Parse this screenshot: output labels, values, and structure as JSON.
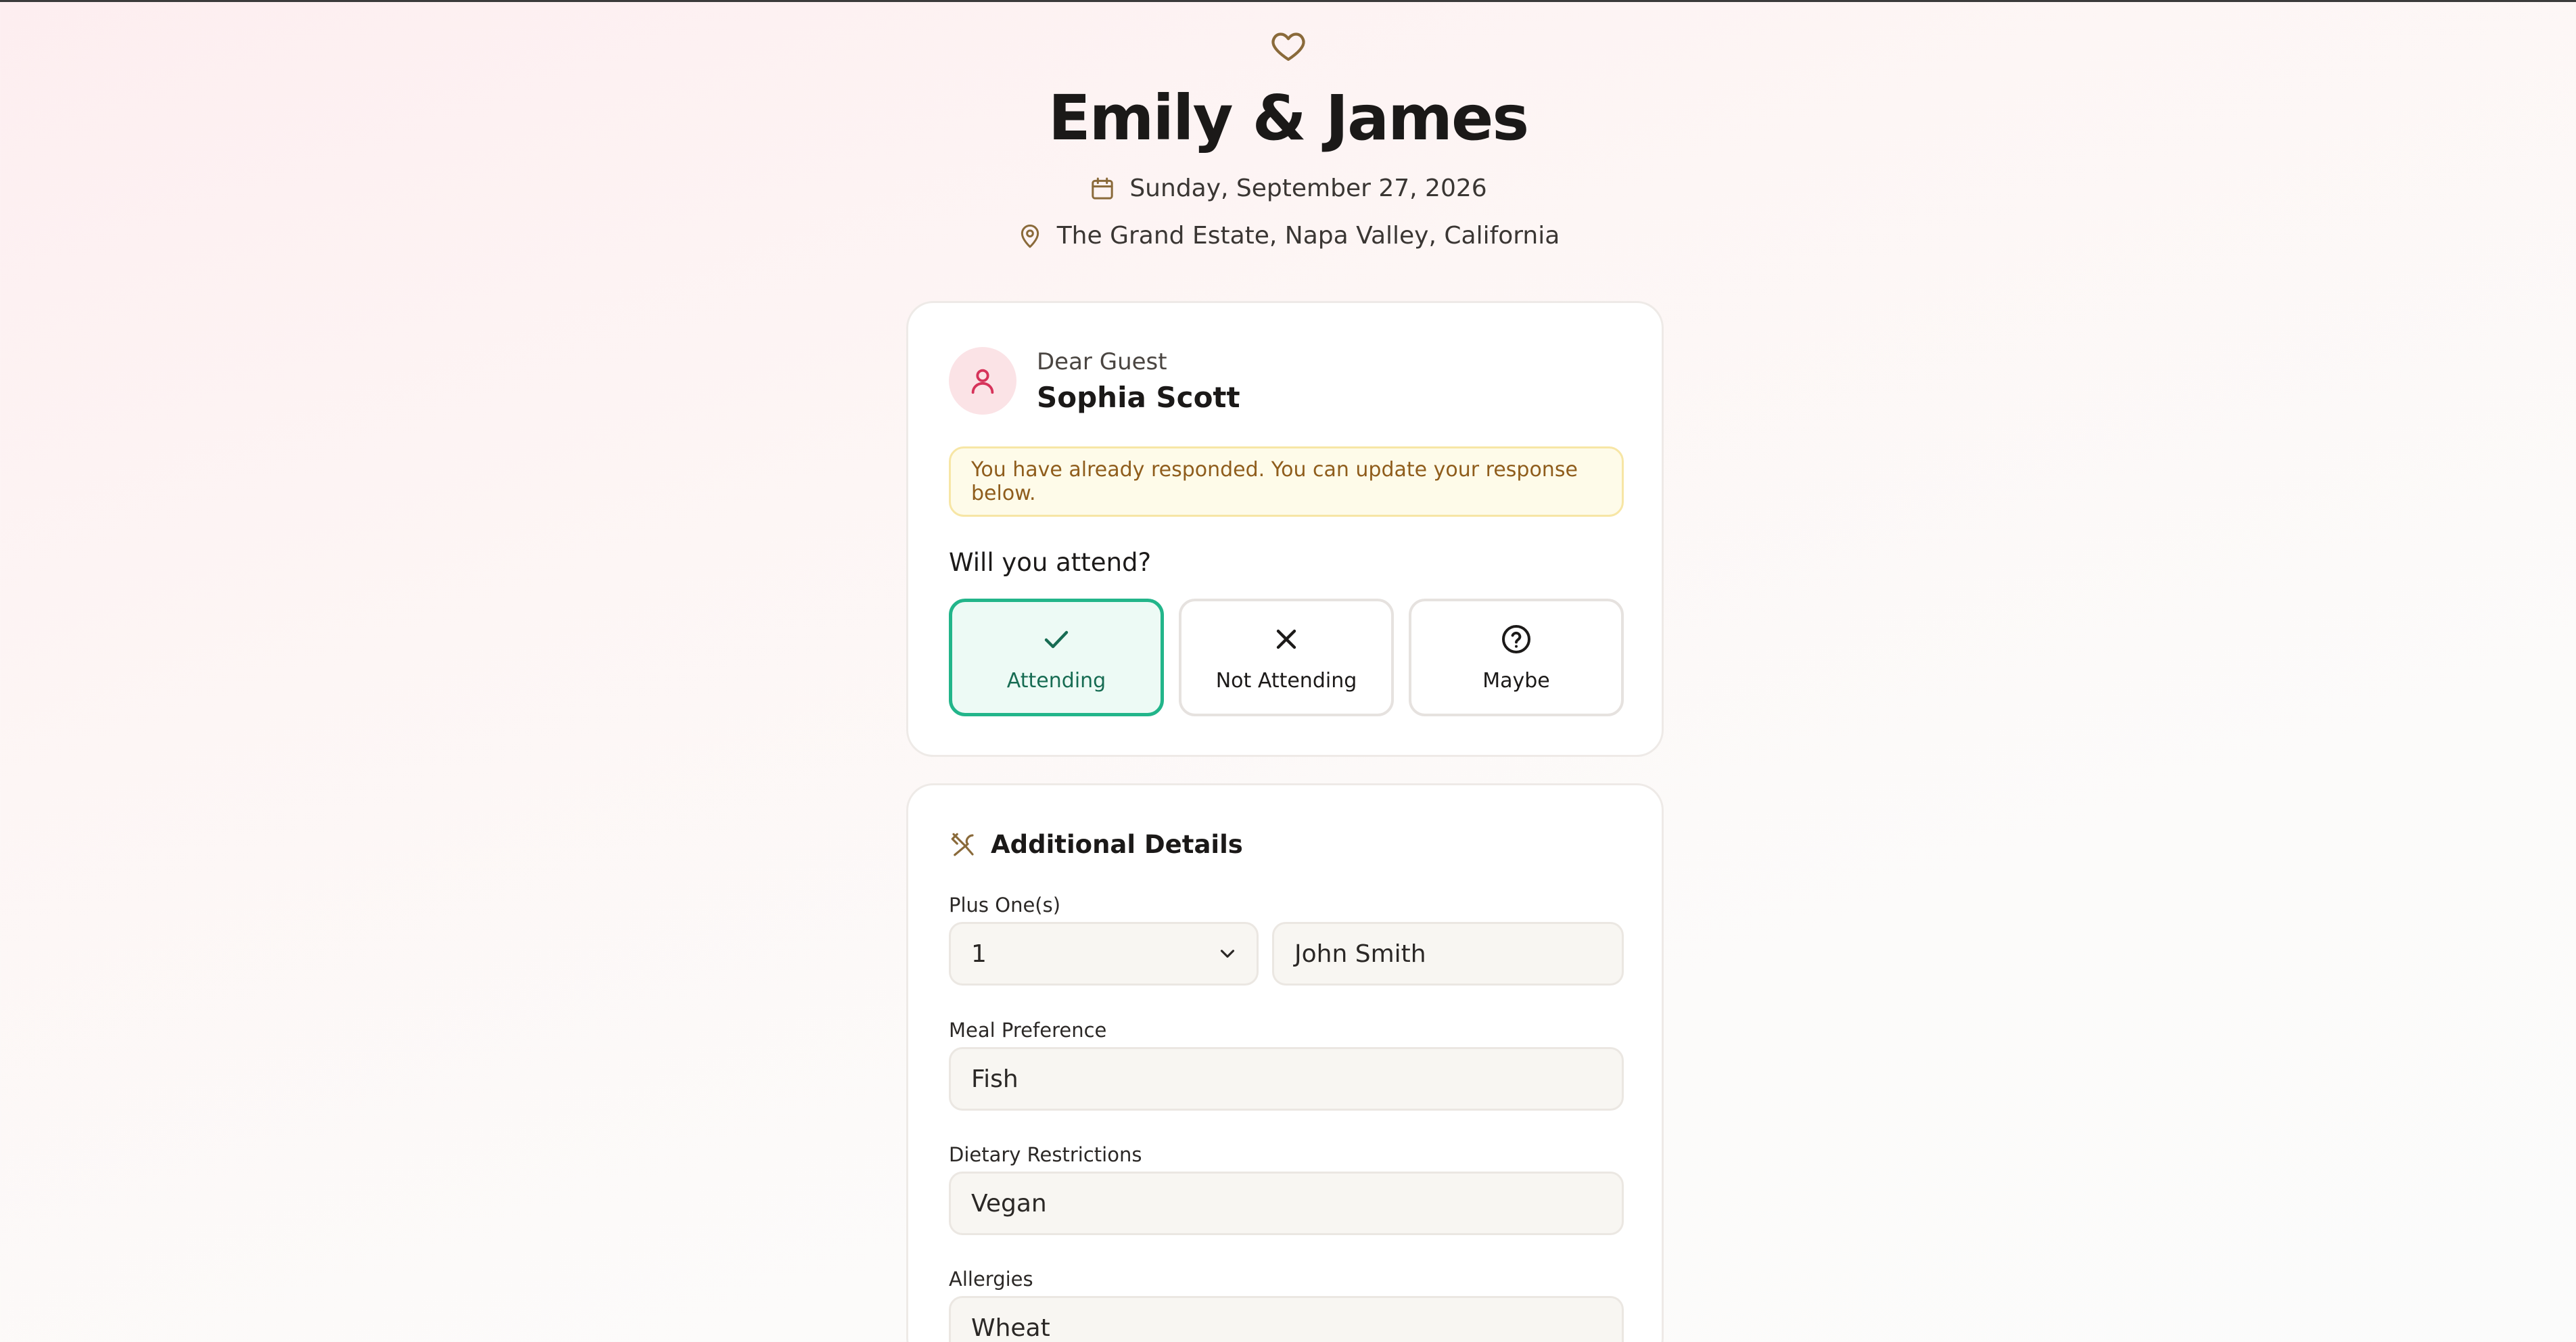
{
  "event": {
    "couple": "Emily & James",
    "date": "Sunday, September 27, 2026",
    "location": "The Grand Estate, Napa Valley, California"
  },
  "guest": {
    "greeting": "Dear Guest",
    "name": "Sophia Scott",
    "notice": "You have already responded. You can update your response below."
  },
  "attendance": {
    "question": "Will you attend?",
    "options": [
      {
        "label": "Attending",
        "icon": "check-icon",
        "selected": true
      },
      {
        "label": "Not Attending",
        "icon": "x-icon",
        "selected": false
      },
      {
        "label": "Maybe",
        "icon": "question-icon",
        "selected": false
      }
    ]
  },
  "details": {
    "title": "Additional Details",
    "plus_one_label": "Plus One(s)",
    "plus_one_count": "1",
    "plus_one_name": "John Smith",
    "meal_label": "Meal Preference",
    "meal_value": "Fish",
    "dietary_label": "Dietary Restrictions",
    "dietary_value": "Vegan",
    "allergies_label": "Allergies",
    "allergies_value": "Wheat"
  },
  "colors": {
    "accent_green": "#22b58a",
    "gold_icon": "#8a6a3a",
    "avatar_pink": "#d6335a",
    "notice_text": "#8f5d1c"
  }
}
